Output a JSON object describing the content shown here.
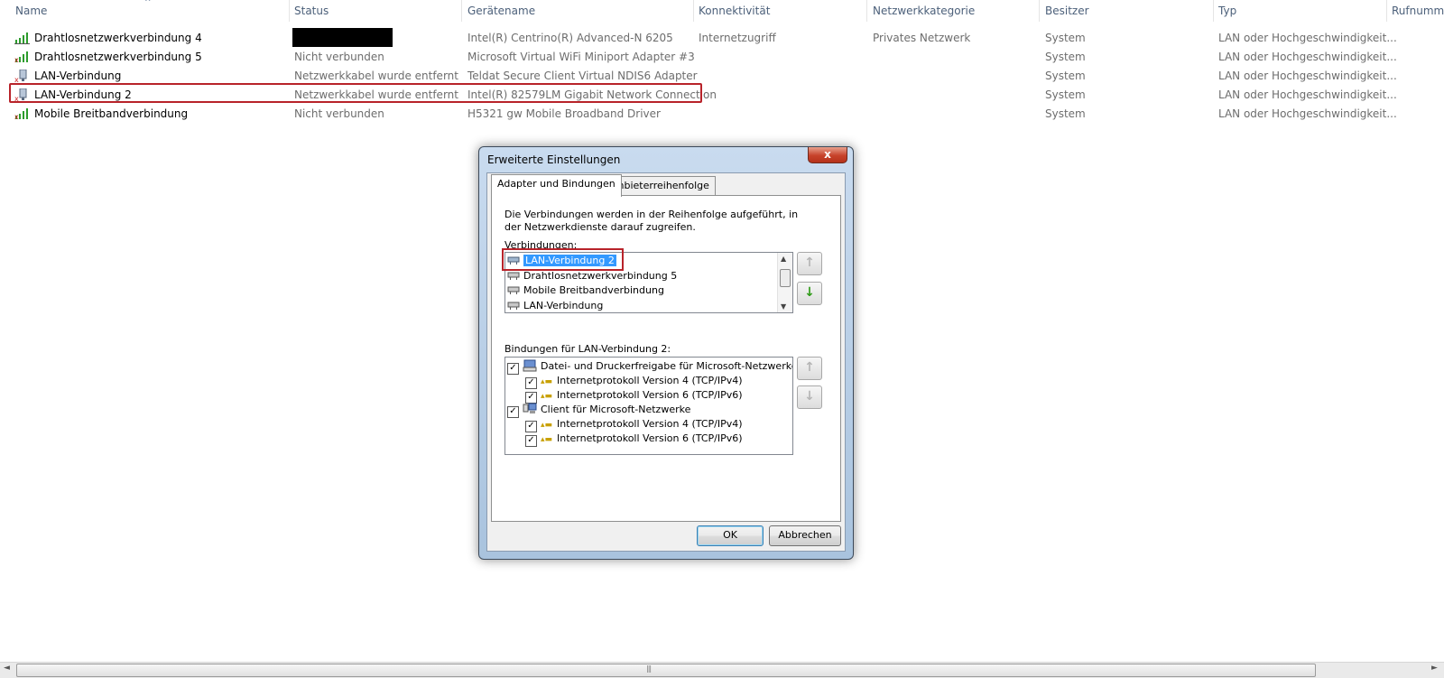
{
  "columns": {
    "name": "Name",
    "status": "Status",
    "device": "Gerätename",
    "connectivity": "Konnektivität",
    "network_category": "Netzwerkkategorie",
    "owner": "Besitzer",
    "type": "Typ",
    "phone": "Rufnumme"
  },
  "rows": [
    {
      "name": "Drahtlosnetzwerkverbindung 4",
      "status": "",
      "device": "Intel(R) Centrino(R) Advanced-N 6205",
      "connectivity": "Internetzugriff",
      "network_category": "Privates Netzwerk",
      "owner": "System",
      "type": "LAN oder Hochgeschwindigkeit...",
      "icon": "wifi-signal-icon"
    },
    {
      "name": "Drahtlosnetzwerkverbindung 5",
      "status": "Nicht verbunden",
      "device": "Microsoft Virtual WiFi Miniport Adapter #3",
      "connectivity": "",
      "network_category": "",
      "owner": "System",
      "type": "LAN oder Hochgeschwindigkeit...",
      "icon": "wifi-signal-icon"
    },
    {
      "name": "LAN-Verbindung",
      "status": "Netzwerkkabel wurde entfernt",
      "device": "Teldat Secure Client Virtual NDIS6 Adapter",
      "connectivity": "",
      "network_category": "",
      "owner": "System",
      "type": "LAN oder Hochgeschwindigkeit...",
      "icon": "lan-disconnected-icon"
    },
    {
      "name": "LAN-Verbindung 2",
      "status": "Netzwerkkabel wurde entfernt",
      "device": "Intel(R) 82579LM Gigabit Network Connection",
      "connectivity": "",
      "network_category": "",
      "owner": "System",
      "type": "LAN oder Hochgeschwindigkeit...",
      "icon": "lan-disconnected-icon"
    },
    {
      "name": "Mobile Breitbandverbindung",
      "status": "Nicht verbunden",
      "device": "H5321 gw Mobile Broadband Driver",
      "connectivity": "",
      "network_category": "",
      "owner": "System",
      "type": "LAN oder Hochgeschwindigkeit...",
      "icon": "mobile-broadband-icon"
    }
  ],
  "dialog": {
    "title": "Erweiterte Einstellungen",
    "close_label": "x",
    "tabs": [
      "Adapter und Bindungen",
      "Anbieterreihenfolge"
    ],
    "description": "Die Verbindungen werden in der Reihenfolge aufgeführt, in der Netzwerkdienste darauf zugreifen.",
    "connections_label": "Verbindungen:",
    "connections": [
      "LAN-Verbindung 2",
      "Drahtlosnetzwerkverbindung 5",
      "Mobile Breitbandverbindung",
      "LAN-Verbindung"
    ],
    "selected_connection": "LAN-Verbindung 2",
    "bindings_label": "Bindungen für LAN-Verbindung 2:",
    "bindings": [
      {
        "label": "Datei- und Druckerfreigabe für Microsoft-Netzwerke",
        "level": 0,
        "checked": true,
        "icon": "file-printer-sharing-icon"
      },
      {
        "label": "Internetprotokoll Version 4 (TCP/IPv4)",
        "level": 1,
        "checked": true,
        "icon": "protocol-icon"
      },
      {
        "label": "Internetprotokoll Version 6 (TCP/IPv6)",
        "level": 1,
        "checked": true,
        "icon": "protocol-icon"
      },
      {
        "label": "Client für Microsoft-Netzwerke",
        "level": 0,
        "checked": true,
        "icon": "client-network-icon"
      },
      {
        "label": "Internetprotokoll Version 4 (TCP/IPv4)",
        "level": 1,
        "checked": true,
        "icon": "protocol-icon"
      },
      {
        "label": "Internetprotokoll Version 6 (TCP/IPv6)",
        "level": 1,
        "checked": true,
        "icon": "protocol-icon"
      }
    ],
    "ok_label": "OK",
    "cancel_label": "Abbrechen"
  },
  "colors": {
    "highlight_border": "#b8232a",
    "selection": "#3399ff",
    "header_text": "#4c607a"
  }
}
